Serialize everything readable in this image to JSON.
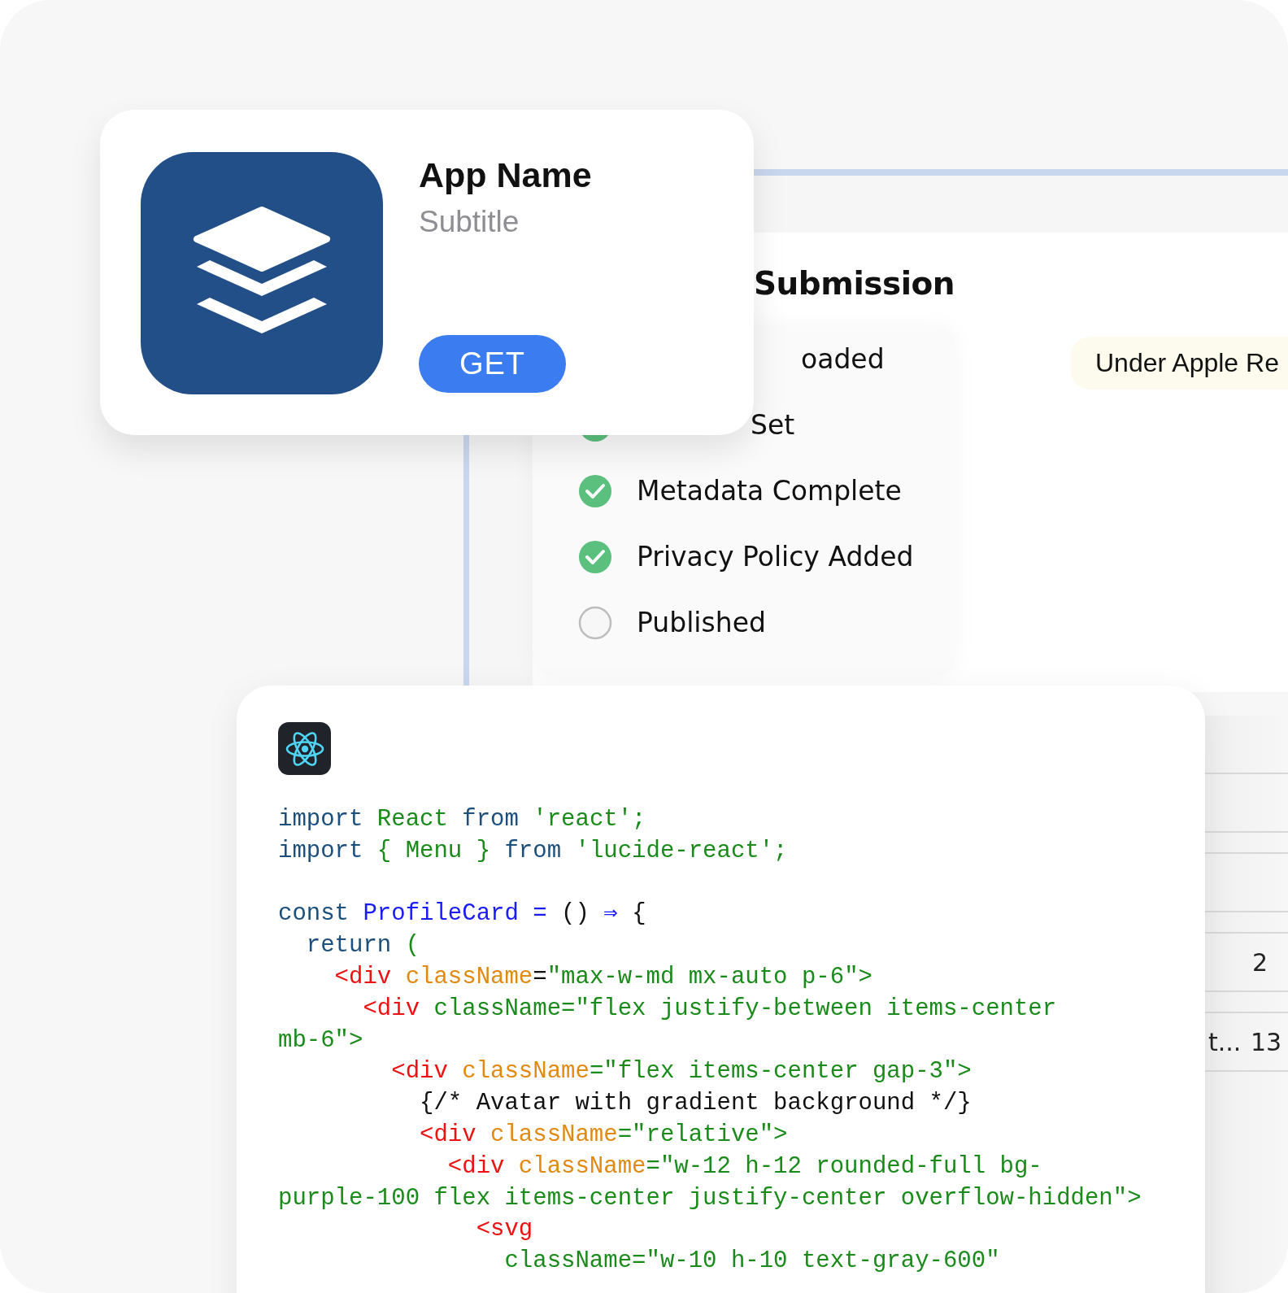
{
  "app_card": {
    "name": "App Name",
    "subtitle": "Subtitle",
    "button": "GET"
  },
  "submission": {
    "title": "Submission",
    "status_badge": "Under Apple Re",
    "items": [
      {
        "label": "oaded"
      },
      {
        "label": "Set",
        "checked": true
      },
      {
        "label": "Metadata Complete",
        "checked": true
      },
      {
        "label": "Privacy Policy Added",
        "checked": true
      },
      {
        "label": "Published",
        "checked": false
      }
    ]
  },
  "table": {
    "rows": [
      {
        "column_2": "2"
      },
      {
        "column_1": "t...",
        "column_2": "13"
      }
    ]
  },
  "code": {
    "lines": [
      {
        "tokens": [
          {
            "text": "import",
            "kind": "keyword"
          },
          {
            "text": " React ",
            "kind": "identifier"
          },
          {
            "text": "from",
            "kind": "keyword"
          },
          {
            "text": " 'react';",
            "kind": "string"
          }
        ]
      },
      {
        "tokens": [
          {
            "text": "import",
            "kind": "keyword"
          },
          {
            "text": " { Menu } ",
            "kind": "identifier"
          },
          {
            "text": "from",
            "kind": "keyword"
          },
          {
            "text": " 'lucide-react';",
            "kind": "string"
          }
        ]
      },
      {
        "gap_before": true,
        "tokens": [
          {
            "text": "const ",
            "kind": "keyword"
          },
          {
            "text": "ProfileCard",
            "kind": "name"
          },
          {
            "text": " = ",
            "kind": "operator"
          },
          {
            "text": "() ",
            "kind": "plain"
          },
          {
            "text": "⇒",
            "kind": "operator"
          },
          {
            "text": " {",
            "kind": "plain"
          }
        ]
      },
      {
        "tokens": [
          {
            "text": "  return",
            "kind": "keyword"
          },
          {
            "text": " (",
            "kind": "string"
          }
        ]
      },
      {
        "tokens": [
          {
            "text": "    <div",
            "kind": "tag"
          },
          {
            "text": " className",
            "kind": "attribute"
          },
          {
            "text": "=",
            "kind": "plain"
          },
          {
            "text": "\"max-w-md mx-auto p-6\">",
            "kind": "string"
          }
        ]
      },
      {
        "tokens": [
          {
            "text": "      <div",
            "kind": "tag"
          },
          {
            "text": " className=\"flex justify-between items-center",
            "kind": "string"
          }
        ]
      },
      {
        "tokens": [
          {
            "text": "mb-6\">",
            "kind": "string"
          }
        ]
      },
      {
        "tokens": [
          {
            "text": "        <div",
            "kind": "tag"
          },
          {
            "text": " className",
            "kind": "attribute"
          },
          {
            "text": "=\"flex items-center gap-3\">",
            "kind": "string"
          }
        ]
      },
      {
        "tokens": [
          {
            "text": "          {/* Avatar with gradient background */}",
            "kind": "plain"
          }
        ]
      },
      {
        "tokens": [
          {
            "text": "          <div",
            "kind": "tag"
          },
          {
            "text": " className",
            "kind": "attribute"
          },
          {
            "text": "=\"relative\">",
            "kind": "string"
          }
        ]
      },
      {
        "tokens": [
          {
            "text": "            <div",
            "kind": "tag"
          },
          {
            "text": " className",
            "kind": "attribute"
          },
          {
            "text": "=\"w-12 h-12 rounded-full bg-",
            "kind": "string"
          }
        ]
      },
      {
        "tokens": [
          {
            "text": "purple-100 flex items-center justify-center overflow-hidden\">",
            "kind": "string"
          }
        ]
      },
      {
        "tokens": [
          {
            "text": "              <svg",
            "kind": "tag"
          }
        ]
      },
      {
        "tokens": [
          {
            "text": "                className=\"w-10 h-10 text-gray-600\"",
            "kind": "string"
          }
        ]
      }
    ]
  }
}
